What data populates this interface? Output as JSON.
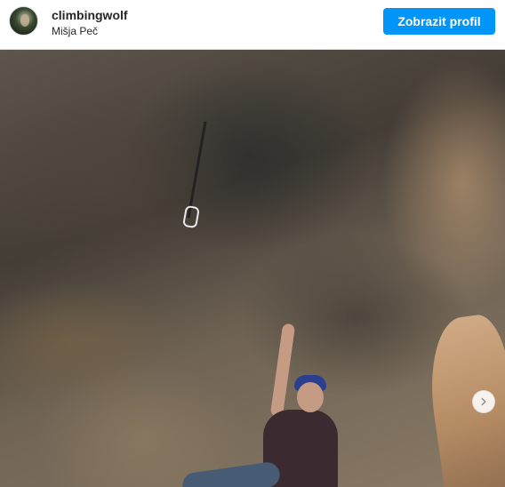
{
  "header": {
    "username": "climbingwolf",
    "location": "Mišja Peč",
    "profile_button_label": "Zobrazit profil",
    "accent_color": "#0095f6",
    "avatar_icon": "avatar-icon"
  },
  "media": {
    "type": "photo",
    "next_icon": "chevron-right-icon"
  }
}
